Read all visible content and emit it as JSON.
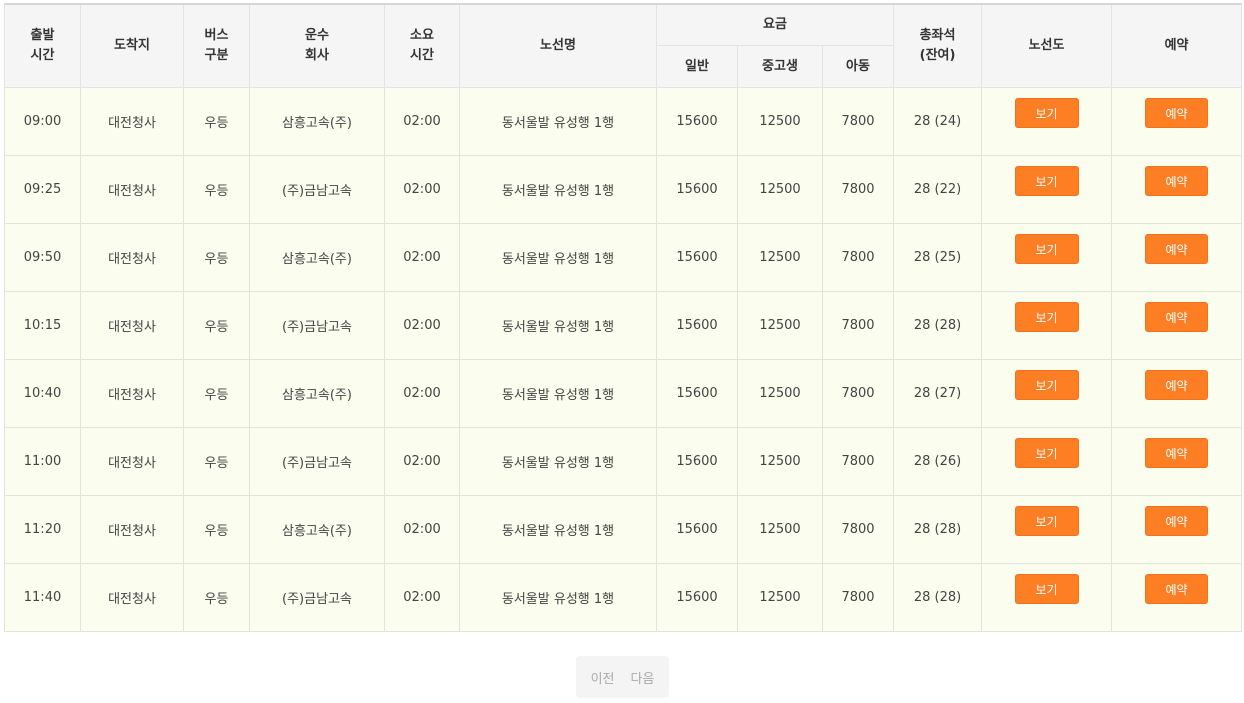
{
  "headers": {
    "depart_1": "출발",
    "depart_2": "시간",
    "dest": "도착지",
    "bus_1": "버스",
    "bus_2": "구분",
    "company_1": "운수",
    "company_2": "회사",
    "duration_1": "소요",
    "duration_2": "시간",
    "route": "노선명",
    "fare": "요금",
    "fare_adult": "일반",
    "fare_student": "중고생",
    "fare_child": "아동",
    "seats_1": "총좌석",
    "seats_2": "(잔여)",
    "map": "노선도",
    "reserve": "예약"
  },
  "buttons": {
    "view": "보기",
    "reserve": "예약"
  },
  "colors": {
    "accent": "#fd7e23",
    "row_bg": "#fbfdef",
    "header_bg": "#f5f5f5"
  },
  "rows": [
    {
      "time": "09:00",
      "dest": "대전청사",
      "type": "우등",
      "company": "삼흥고속(주)",
      "duration": "02:00",
      "route": "동서울발 유성행 1행",
      "adult": "15600",
      "student": "12500",
      "child": "7800",
      "seats": "28 (24)"
    },
    {
      "time": "09:25",
      "dest": "대전청사",
      "type": "우등",
      "company": "(주)금남고속",
      "duration": "02:00",
      "route": "동서울발 유성행 1행",
      "adult": "15600",
      "student": "12500",
      "child": "7800",
      "seats": "28 (22)"
    },
    {
      "time": "09:50",
      "dest": "대전청사",
      "type": "우등",
      "company": "삼흥고속(주)",
      "duration": "02:00",
      "route": "동서울발 유성행 1행",
      "adult": "15600",
      "student": "12500",
      "child": "7800",
      "seats": "28 (25)"
    },
    {
      "time": "10:15",
      "dest": "대전청사",
      "type": "우등",
      "company": "(주)금남고속",
      "duration": "02:00",
      "route": "동서울발 유성행 1행",
      "adult": "15600",
      "student": "12500",
      "child": "7800",
      "seats": "28 (28)"
    },
    {
      "time": "10:40",
      "dest": "대전청사",
      "type": "우등",
      "company": "삼흥고속(주)",
      "duration": "02:00",
      "route": "동서울발 유성행 1행",
      "adult": "15600",
      "student": "12500",
      "child": "7800",
      "seats": "28 (27)"
    },
    {
      "time": "11:00",
      "dest": "대전청사",
      "type": "우등",
      "company": "(주)금남고속",
      "duration": "02:00",
      "route": "동서울발 유성행 1행",
      "adult": "15600",
      "student": "12500",
      "child": "7800",
      "seats": "28 (26)"
    },
    {
      "time": "11:20",
      "dest": "대전청사",
      "type": "우등",
      "company": "삼흥고속(주)",
      "duration": "02:00",
      "route": "동서울발 유성행 1행",
      "adult": "15600",
      "student": "12500",
      "child": "7800",
      "seats": "28 (28)"
    },
    {
      "time": "11:40",
      "dest": "대전청사",
      "type": "우등",
      "company": "(주)금남고속",
      "duration": "02:00",
      "route": "동서울발 유성행 1행",
      "adult": "15600",
      "student": "12500",
      "child": "7800",
      "seats": "28 (28)"
    }
  ],
  "pager": {
    "prev": "이전",
    "next": "다음"
  }
}
